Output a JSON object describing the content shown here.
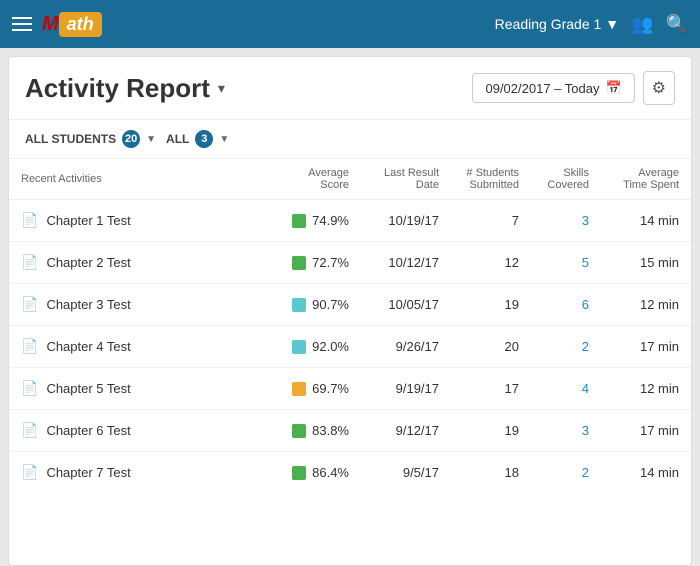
{
  "header": {
    "menu_label": "menu",
    "logo_text": "ath",
    "grade_selector": "Reading Grade 1",
    "dropdown_arrow": "▼"
  },
  "title_bar": {
    "title": "Activity Report",
    "dropdown_icon": "▾",
    "date_range": "09/02/2017 – Today",
    "calendar_icon": "📅",
    "settings_icon": "⚙"
  },
  "filters": {
    "students_label": "ALL STUDENTS",
    "students_count": "20",
    "all_label": "ALL",
    "all_count": "3"
  },
  "table": {
    "headers": {
      "activity": "Recent Activities",
      "avg_score": "Average Score",
      "last_date": "Last Result Date",
      "students": "# Students Submitted",
      "skills": "Skills Covered",
      "time": "Average Time Spent"
    },
    "rows": [
      {
        "name": "Chapter 1 Test",
        "score": "74.9%",
        "score_color": "#4caf50",
        "date": "10/19/17",
        "students": "7",
        "skills": "3",
        "time": "14 min"
      },
      {
        "name": "Chapter 2 Test",
        "score": "72.7%",
        "score_color": "#4caf50",
        "date": "10/12/17",
        "students": "12",
        "skills": "5",
        "time": "15 min"
      },
      {
        "name": "Chapter 3 Test",
        "score": "90.7%",
        "score_color": "#5bc8d0",
        "date": "10/05/17",
        "students": "19",
        "skills": "6",
        "time": "12 min"
      },
      {
        "name": "Chapter 4 Test",
        "score": "92.0%",
        "score_color": "#5bc8d0",
        "date": "9/26/17",
        "students": "20",
        "skills": "2",
        "time": "17 min"
      },
      {
        "name": "Chapter 5 Test",
        "score": "69.7%",
        "score_color": "#f0a830",
        "date": "9/19/17",
        "students": "17",
        "skills": "4",
        "time": "12 min"
      },
      {
        "name": "Chapter 6 Test",
        "score": "83.8%",
        "score_color": "#4caf50",
        "date": "9/12/17",
        "students": "19",
        "skills": "3",
        "time": "17 min"
      },
      {
        "name": "Chapter 7 Test",
        "score": "86.4%",
        "score_color": "#4caf50",
        "date": "9/5/17",
        "students": "18",
        "skills": "2",
        "time": "14 min"
      }
    ]
  }
}
